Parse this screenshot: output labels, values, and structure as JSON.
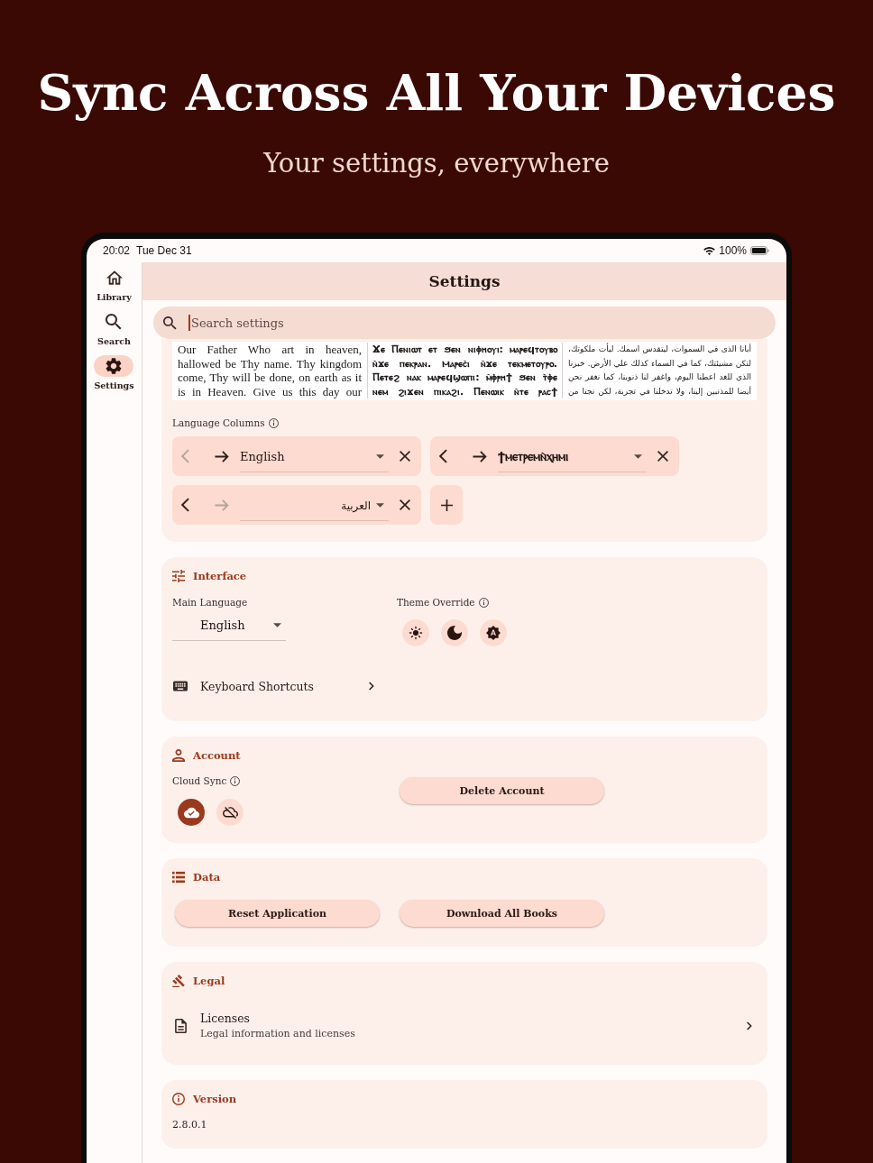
{
  "hero": {
    "title": "Sync Across All Your Devices",
    "subtitle": "Your settings, everywhere"
  },
  "status_bar": {
    "time": "20:02",
    "date": "Tue Dec 31",
    "battery": "100%"
  },
  "sidebar": {
    "items": [
      {
        "kind": "library",
        "label": "Library",
        "selected": false
      },
      {
        "kind": "search",
        "label": "Search",
        "selected": false
      },
      {
        "kind": "settings",
        "label": "Settings",
        "selected": true
      }
    ]
  },
  "app_bar": {
    "title": "Settings"
  },
  "search": {
    "placeholder": "Search settings",
    "focused": true
  },
  "preview": {
    "columns": [
      {
        "kind": "latin",
        "text": "Our Father Who art in heaven, hallowed be Thy name. Thy kingdom come, Thy will be done, on earth as it is in Heaven. Give us this day our"
      },
      {
        "kind": "coptic",
        "text": "Ϫⲉ Ⲡⲉⲛⲓⲱⲧ ⲉⲧ ϧⲉⲛ ⲛⲓⲫⲏⲟⲩⲓ: ⲙⲁⲣⲉϥⲧⲟⲩⲃⲟ ⲛ̀ϫⲉ ⲡⲉⲕⲣⲁⲛ. Ⲙⲁⲣⲉⲥ̀ⲓ ⲛ̀ϫⲉ ⲧⲉⲕⲙⲉⲧⲟⲩⲣⲟ. Ⲡⲉⲧⲉϩ ⲛⲁⲕ ⲙⲁⲣⲉϥϣⲱⲡⲓ: ⲙ̀ⲫⲣⲏϯ ϧⲉⲛ ⲧ̀ⲫⲉ ⲛⲉⲙ ϩⲓϫⲉⲛ ⲡⲓⲕⲁϩⲓ. Ⲡⲉⲛⲱⲓⲕ ⲛ̀ⲧⲉ ⲣⲁⲥϯ"
      },
      {
        "kind": "arabic",
        "text": "أبانا الذى في السموات، ليتقدس اسمك. ليأت ملكوتك، لتكن مشيئتك، كما في السماء كذلك علي الأرض. خبزنا الذي للغد اعطنا اليوم، واغفر لنا ذنوبنا، كما نغفر نحن أيضا للمذنبين إلينا، ولا تدخلنا في تجربة، لكن نجنا من"
      }
    ]
  },
  "language_columns": {
    "label": "Language Columns",
    "columns": [
      {
        "kind": "latin",
        "value": "English",
        "move_left_disabled": true,
        "move_right_disabled": false
      },
      {
        "kind": "coptic",
        "value": "ϯⲙⲉⲧⲣⲉⲙⲛ̀ⲭⲏⲙⲓ",
        "move_left_disabled": false,
        "move_right_disabled": false
      },
      {
        "kind": "arabic",
        "value": "العربية",
        "move_left_disabled": false,
        "move_right_disabled": true
      }
    ]
  },
  "interface": {
    "title": "Interface",
    "main_language": {
      "label": "Main Language",
      "value": "English"
    },
    "theme_override": {
      "label": "Theme Override",
      "options": [
        {
          "kind": "light",
          "selected": false
        },
        {
          "kind": "dark",
          "selected": false
        },
        {
          "kind": "system",
          "selected": false
        }
      ]
    },
    "shortcuts": {
      "label": "Keyboard Shortcuts"
    }
  },
  "account": {
    "title": "Account",
    "cloud_sync": {
      "label": "Cloud Sync",
      "options": [
        {
          "kind": "on",
          "selected": true
        },
        {
          "kind": "off",
          "selected": false
        }
      ]
    },
    "delete_button": "Delete Account"
  },
  "data": {
    "title": "Data",
    "buttons": [
      "Reset Application",
      "Download All Books"
    ]
  },
  "legal": {
    "title": "Legal",
    "items": [
      {
        "title": "Licenses",
        "subtitle": "Legal information and licenses"
      }
    ]
  },
  "version": {
    "title": "Version",
    "value": "2.8.0.1"
  }
}
